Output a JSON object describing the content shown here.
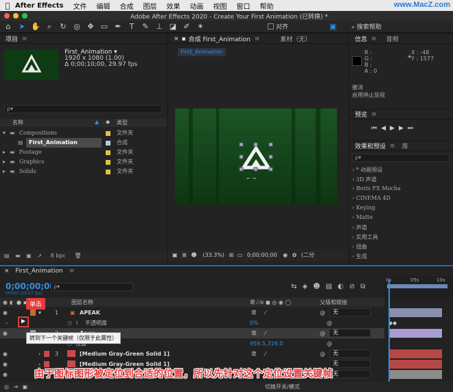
{
  "menubar": {
    "app": "After Effects",
    "items": [
      "文件",
      "编辑",
      "合成",
      "图层",
      "效果",
      "动画",
      "视图",
      "窗口",
      "帮助"
    ],
    "watermark": "www.MacZ.com"
  },
  "window": {
    "title": "Adobe After Effects 2020 - Create Your First Animation (已转换)  *"
  },
  "toolbar": {
    "snap_label": "对齐",
    "search_help": "搜索帮助"
  },
  "project": {
    "title": "项目",
    "comp_name": "First_Animation ▾",
    "comp_size": "1920 x 1080 (1.00)",
    "comp_duration": "Δ 0;00;10;00, 29.97 fps",
    "search_placeholder": "ρ▾",
    "col_name": "名称",
    "col_type": "类型",
    "rows": [
      {
        "name": "Compositions",
        "type": "文件夹"
      },
      {
        "name": "First_Animation",
        "type": "合成"
      },
      {
        "name": "Footage",
        "type": "文件夹"
      },
      {
        "name": "Graphics",
        "type": "文件夹"
      },
      {
        "name": "Solids",
        "type": "文件夹"
      }
    ],
    "bpc": "8 bpc"
  },
  "viewer": {
    "tab_comp": "合成 First_Animation",
    "tab_footage": "素材（无）",
    "comp_tag": "First_Animation",
    "zoom": "(33.3%)",
    "timecode": "0;00;00;00",
    "mode": "(二分"
  },
  "info": {
    "tab_info": "信息",
    "tab_audio": "音频",
    "r": "R :",
    "g": "G :",
    "b": "B :",
    "a": "A : 0",
    "x": "X : -48",
    "y": "Y : 1577",
    "undo": "撤消",
    "monitor": "启用停止监视"
  },
  "preview": {
    "title": "预览"
  },
  "effects": {
    "tab_effects": "效果和预设",
    "tab_library": "库",
    "items": [
      "* 动画预设",
      "3D 声道",
      "Boris FX Mocha",
      "CINEMA 4D",
      "Keying",
      "Matte",
      "声道",
      "实用工具",
      "扭曲",
      "生成"
    ]
  },
  "timeline": {
    "tab": "First_Animation",
    "timecode": "0;00;00;00",
    "fps_sub": "00000 (29.97 fps)",
    "col_layer": "图层名称",
    "col_parent": "父级和链接",
    "ruler": [
      "0s",
      "05s",
      "10s"
    ],
    "layers": [
      {
        "num": "1",
        "name": "APEAK",
        "color": "#c76b2e",
        "parent": "无"
      },
      {
        "sub": "不透明度",
        "value": "0%"
      },
      {
        "num": "2",
        "name": "Apex",
        "color": "#a99ad0",
        "parent": "无"
      },
      {
        "sub": "位置",
        "value": "959.5,316.0"
      },
      {
        "num": "3",
        "name": "[Medium Gray-Green Solid 1]",
        "color": "#c94a4a",
        "parent": "无"
      },
      {
        "num": "4",
        "name": "[Medium Gray-Green Solid 1]",
        "color": "#c94a4a",
        "parent": "无"
      },
      {
        "num": "5",
        "name": "",
        "color": "#c94a4a",
        "parent": "无"
      }
    ],
    "footer": "切换开关/模式"
  },
  "annotations": {
    "callout": "单击",
    "tooltip": "转到下一个关键帧（仅限于此属性）",
    "caption": "由于图标图形被定位到合适的位置，所以先针对这个定位设置关键帧"
  }
}
